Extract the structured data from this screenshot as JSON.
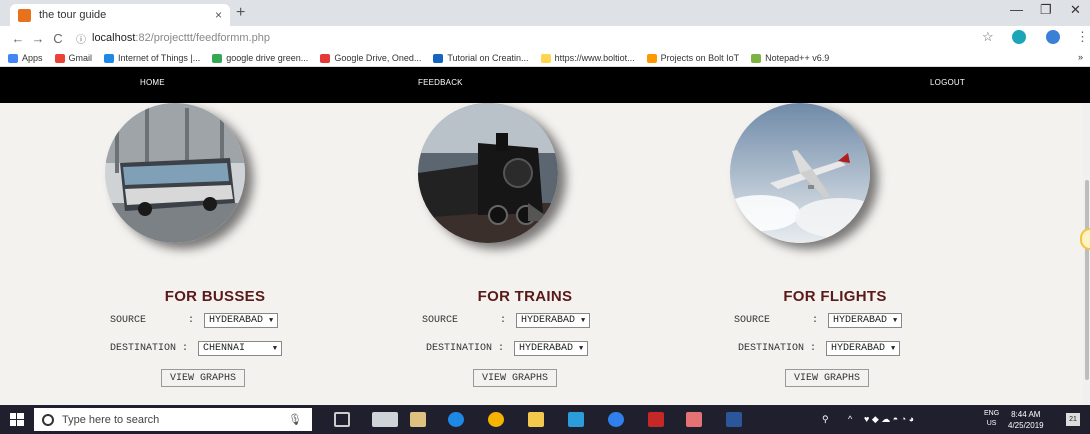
{
  "browser": {
    "tab_title": "the tour guide",
    "tab_close": "×",
    "new_tab": "+",
    "url_host": "localhost",
    "url_path": ":82/projecttt/feedformm.php",
    "win_min": "—",
    "win_max": "❐",
    "win_close": "✕",
    "back": "←",
    "forward": "→",
    "reload": "C",
    "info": "ⓘ",
    "star": "☆",
    "menu": "⋮"
  },
  "bookmarks": [
    {
      "label": "Apps",
      "color": "#4285f4"
    },
    {
      "label": "Gmail",
      "color": "#ea4335"
    },
    {
      "label": "Internet of Things |...",
      "color": "#1e88e5"
    },
    {
      "label": "google drive green...",
      "color": "#34a853"
    },
    {
      "label": "Google Drive, Oned...",
      "color": "#e53935"
    },
    {
      "label": "Tutorial on Creatin...",
      "color": "#1565c0"
    },
    {
      "label": "https://www.boltiot...",
      "color": "#ffd54f"
    },
    {
      "label": "Projects on Bolt IoT",
      "color": "#ff9800"
    },
    {
      "label": "Notepad++ v6.9",
      "color": "#7cb342"
    }
  ],
  "bookmarks_overflow": "»",
  "nav": {
    "home": "HOME",
    "feedback": "FEEDBACK",
    "logout": "LOGOUT"
  },
  "sections": [
    {
      "heading": "FOR BUSSES",
      "source_label": "SOURCE       : ",
      "source_value": "HYDERABAD",
      "dest_label": "DESTINATION : ",
      "dest_value": "CHENNAI",
      "button": "VIEW GRAPHS"
    },
    {
      "heading": "FOR TRAINS",
      "source_label": "SOURCE       : ",
      "source_value": "HYDERABAD",
      "dest_label": "DESTINATION : ",
      "dest_value": "HYDERABAD",
      "button": "VIEW GRAPHS"
    },
    {
      "heading": "FOR FLIGHTS",
      "source_label": "SOURCE       : ",
      "source_value": "HYDERABAD",
      "dest_label": "DESTINATION : ",
      "dest_value": "HYDERABAD",
      "button": "VIEW GRAPHS"
    }
  ],
  "taskbar": {
    "search_placeholder": "Type here to search",
    "lang_top": "ENG",
    "lang_bottom": "US",
    "time": "8:44 AM",
    "date": "4/25/2019",
    "notifications": "21"
  },
  "colors": {
    "nav_bg": "#000000",
    "heading": "#5a1a1a",
    "page_bg": "#f4f2ef",
    "taskbar": "#1f1f2e"
  }
}
